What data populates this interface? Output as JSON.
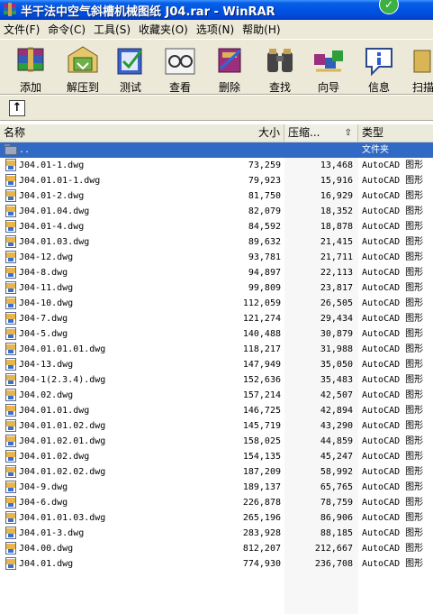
{
  "window": {
    "title": "半干法中空气斜槽机械图纸 J04.rar - WinRAR"
  },
  "menu": [
    "文件(F)",
    "命令(C)",
    "工具(S)",
    "收藏夹(O)",
    "选项(N)",
    "帮助(H)"
  ],
  "toolbar": [
    {
      "label": "添加",
      "icon": "add-archive-icon"
    },
    {
      "label": "解压到",
      "icon": "extract-to-icon"
    },
    {
      "label": "测试",
      "icon": "test-icon"
    },
    {
      "label": "查看",
      "icon": "view-icon"
    },
    {
      "label": "删除",
      "icon": "delete-icon"
    },
    {
      "label": "查找",
      "icon": "find-icon"
    },
    {
      "label": "向导",
      "icon": "wizard-icon"
    },
    {
      "label": "信息",
      "icon": "info-icon"
    },
    {
      "label": "扫描",
      "icon": "scan-icon"
    }
  ],
  "columns": {
    "name": "名称",
    "size": "大小",
    "packed": "压缩...",
    "type": "类型"
  },
  "parent_row": {
    "name": "..",
    "type": "文件夹"
  },
  "files": [
    {
      "name": "J04.01-1.dwg",
      "size": "73,259",
      "packed": "13,468",
      "type": "AutoCAD 图形"
    },
    {
      "name": "J04.01.01-1.dwg",
      "size": "79,923",
      "packed": "15,916",
      "type": "AutoCAD 图形"
    },
    {
      "name": "J04.01-2.dwg",
      "size": "81,750",
      "packed": "16,929",
      "type": "AutoCAD 图形"
    },
    {
      "name": "J04.01.04.dwg",
      "size": "82,079",
      "packed": "18,352",
      "type": "AutoCAD 图形"
    },
    {
      "name": "J04.01-4.dwg",
      "size": "84,592",
      "packed": "18,878",
      "type": "AutoCAD 图形"
    },
    {
      "name": "J04.01.03.dwg",
      "size": "89,632",
      "packed": "21,415",
      "type": "AutoCAD 图形"
    },
    {
      "name": "J04-12.dwg",
      "size": "93,781",
      "packed": "21,711",
      "type": "AutoCAD 图形"
    },
    {
      "name": "J04-8.dwg",
      "size": "94,897",
      "packed": "22,113",
      "type": "AutoCAD 图形"
    },
    {
      "name": "J04-11.dwg",
      "size": "99,809",
      "packed": "23,817",
      "type": "AutoCAD 图形"
    },
    {
      "name": "J04-10.dwg",
      "size": "112,059",
      "packed": "26,505",
      "type": "AutoCAD 图形"
    },
    {
      "name": "J04-7.dwg",
      "size": "121,274",
      "packed": "29,434",
      "type": "AutoCAD 图形"
    },
    {
      "name": "J04-5.dwg",
      "size": "140,488",
      "packed": "30,879",
      "type": "AutoCAD 图形"
    },
    {
      "name": "J04.01.01.01.dwg",
      "size": "118,217",
      "packed": "31,988",
      "type": "AutoCAD 图形"
    },
    {
      "name": "J04-13.dwg",
      "size": "147,949",
      "packed": "35,050",
      "type": "AutoCAD 图形"
    },
    {
      "name": "J04-1(2.3.4).dwg",
      "size": "152,636",
      "packed": "35,483",
      "type": "AutoCAD 图形"
    },
    {
      "name": "J04.02.dwg",
      "size": "157,214",
      "packed": "42,507",
      "type": "AutoCAD 图形"
    },
    {
      "name": "J04.01.01.dwg",
      "size": "146,725",
      "packed": "42,894",
      "type": "AutoCAD 图形"
    },
    {
      "name": "J04.01.01.02.dwg",
      "size": "145,719",
      "packed": "43,290",
      "type": "AutoCAD 图形"
    },
    {
      "name": "J04.01.02.01.dwg",
      "size": "158,025",
      "packed": "44,859",
      "type": "AutoCAD 图形"
    },
    {
      "name": "J04.01.02.dwg",
      "size": "154,135",
      "packed": "45,247",
      "type": "AutoCAD 图形"
    },
    {
      "name": "J04.01.02.02.dwg",
      "size": "187,209",
      "packed": "58,992",
      "type": "AutoCAD 图形"
    },
    {
      "name": "J04-9.dwg",
      "size": "189,137",
      "packed": "65,765",
      "type": "AutoCAD 图形"
    },
    {
      "name": "J04-6.dwg",
      "size": "226,878",
      "packed": "78,759",
      "type": "AutoCAD 图形"
    },
    {
      "name": "J04.01.01.03.dwg",
      "size": "265,196",
      "packed": "86,906",
      "type": "AutoCAD 图形"
    },
    {
      "name": "J04.01-3.dwg",
      "size": "283,928",
      "packed": "88,185",
      "type": "AutoCAD 图形"
    },
    {
      "name": "J04.00.dwg",
      "size": "812,207",
      "packed": "212,667",
      "type": "AutoCAD 图形"
    },
    {
      "name": "J04.01.dwg",
      "size": "774,930",
      "packed": "236,708",
      "type": "AutoCAD 图形"
    }
  ],
  "colors": {
    "titlebar": "#0054e3",
    "selection": "#316ac5",
    "chrome": "#ece9d8"
  }
}
